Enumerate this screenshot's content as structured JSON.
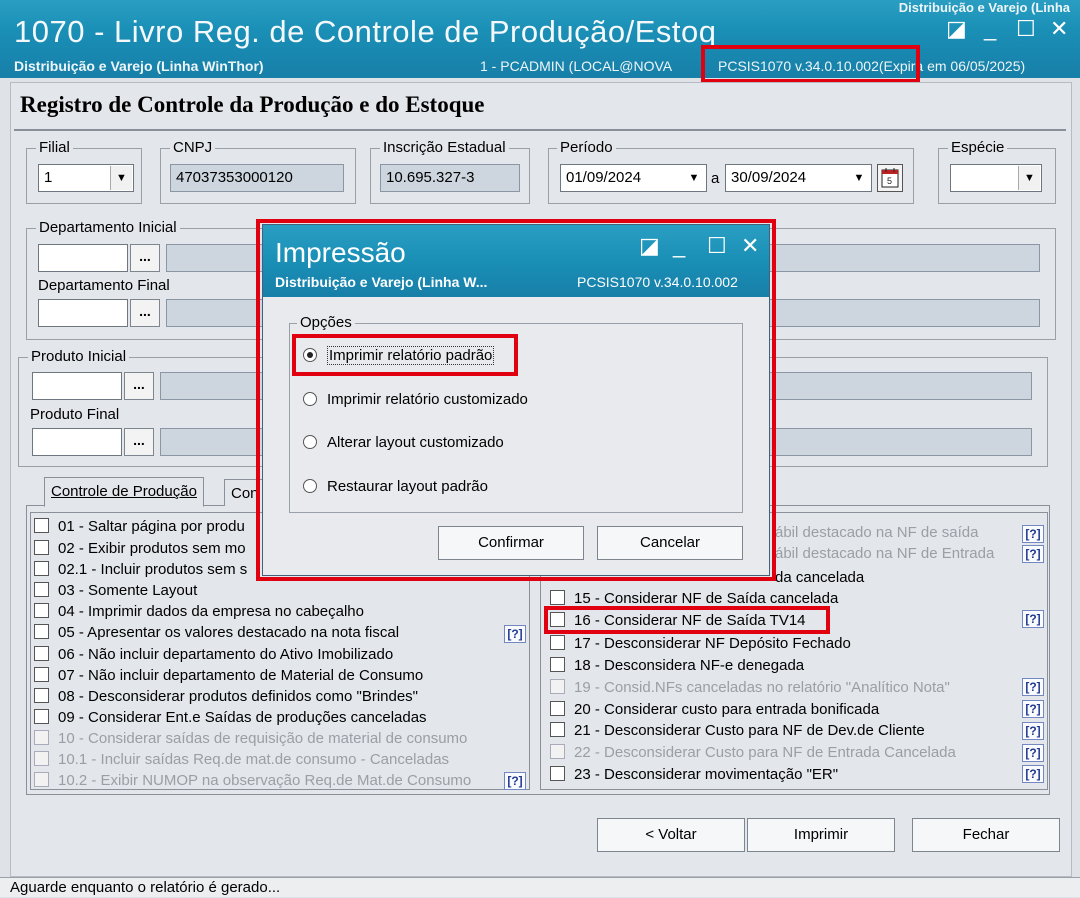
{
  "window": {
    "title": "1070 - Livro Reg. de Controle de Produção/Estoq",
    "subtitle": "Distribuição e Varejo (Linha WinThor)",
    "user_info": "1 - PCADMIN (LOCAL@NOVA",
    "version": "PCSIS1070  v.34.0.10.002(Expira em 06/05/2025)",
    "top_corner": "Distribuição e Varejo (Linha",
    "restore_icon": "◪",
    "min_icon": "_",
    "max_icon": "☐",
    "close_icon": "✕"
  },
  "page": {
    "title": "Registro de Controle da Produção e do Estoque"
  },
  "filters": {
    "filial_label": "Filial",
    "filial_value": "1",
    "cnpj_label": "CNPJ",
    "cnpj_value": "47037353000120",
    "ie_label": "Inscrição Estadual",
    "ie_value": "10.695.327-3",
    "periodo_label": "Período",
    "periodo_start": "01/09/2024",
    "periodo_sep": "a",
    "periodo_end": "30/09/2024",
    "especie_label": "Espécie",
    "especie_value": "",
    "dept_group_label": "Departamento Inicial",
    "dept_final_label": "Departamento Final",
    "prod_group_label": "Produto Inicial",
    "prod_final_label": "Produto Final",
    "ellipsis": "..."
  },
  "tabs": [
    {
      "label": "Controle de Produção"
    },
    {
      "label": "Con"
    }
  ],
  "left_options": [
    {
      "label": "01 - Saltar página por produ",
      "enabled": true
    },
    {
      "label": "02 - Exibir produtos sem mo",
      "enabled": true
    },
    {
      "label": "02.1 - Incluir produtos sem s",
      "enabled": true
    },
    {
      "label": "03 - Somente Layout",
      "enabled": true
    },
    {
      "label": "04 - Imprimir dados da empresa no cabeçalho",
      "enabled": true
    },
    {
      "label": "05 - Apresentar os valores destacado na nota fiscal",
      "enabled": true
    },
    {
      "label": "06 - Não incluir departamento do Ativo Imobilizado",
      "enabled": true
    },
    {
      "label": "07 - Não incluir departamento de Material de Consumo",
      "enabled": true
    },
    {
      "label": "08 - Desconsiderar produtos definidos como \"Brindes\"",
      "enabled": true
    },
    {
      "label": "09 - Considerar Ent.e Saídas de produções canceladas",
      "enabled": true
    },
    {
      "label": "10 - Considerar saídas de requisição de material de consumo",
      "enabled": false
    },
    {
      "label": "10.1 - Incluir saídas Req.de mat.de consumo - Canceladas",
      "enabled": false
    },
    {
      "label": "10.2 - Exibir NUMOP na observação Req.de Mat.de Consumo",
      "enabled": false
    }
  ],
  "right_options": [
    {
      "label": "ábil destacado na NF de saída",
      "enabled": false
    },
    {
      "label": "ábil destacado na NF de Entrada",
      "enabled": false
    },
    {
      "label": "da cancelada",
      "enabled": true
    },
    {
      "label": "15 - Considerar NF de Saída cancelada",
      "enabled": true
    },
    {
      "label": "16 - Considerar NF de Saída TV14",
      "enabled": true
    },
    {
      "label": "17 - Desconsiderar NF Depósito Fechado",
      "enabled": true
    },
    {
      "label": "18 - Desconsidera NF-e denegada",
      "enabled": true
    },
    {
      "label": "19 - Consid.NFs canceladas no relatório \"Analítico Nota\"",
      "enabled": false
    },
    {
      "label": "20 - Considerar custo para entrada bonificada",
      "enabled": true
    },
    {
      "label": "21 - Desconsiderar Custo para NF de Dev.de Cliente",
      "enabled": true
    },
    {
      "label": "22 - Desconsiderar Custo para NF de Entrada Cancelada",
      "enabled": false
    },
    {
      "label": "23 - Desconsiderar movimentação \"ER\"",
      "enabled": true
    }
  ],
  "help_icon": "?",
  "buttons": {
    "voltar": "< Voltar",
    "imprimir": "Imprimir",
    "fechar": "Fechar"
  },
  "status": "Aguarde enquanto o relatório é gerado...",
  "dialog": {
    "title": "Impressão",
    "subtitle": "Distribuição e Varejo (Linha W...",
    "version": "PCSIS1070  v.34.0.10.002",
    "group_label": "Opções",
    "options": [
      {
        "label": "Imprimir relatório padrão",
        "selected": true
      },
      {
        "label": "Imprimir relatório customizado",
        "selected": false
      },
      {
        "label": "Alterar layout customizado",
        "selected": false
      },
      {
        "label": "Restaurar layout padrão",
        "selected": false
      }
    ],
    "confirm": "Confirmar",
    "cancel": "Cancelar"
  },
  "colors": {
    "titlebar": "#1a8fb6",
    "highlight": "#e00010"
  }
}
